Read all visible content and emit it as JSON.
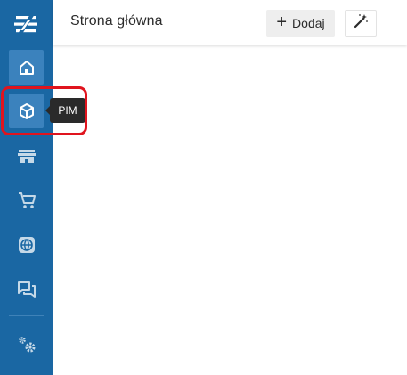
{
  "colors": {
    "sidebar_bg": "#1a67a3",
    "sidebar_active": "#3b82bd",
    "tooltip_bg": "#2a2a2a",
    "highlight": "#e0141e"
  },
  "sidebar": {
    "logo_icon": "logo-icon",
    "items": [
      {
        "id": "home",
        "icon": "home-icon",
        "active": true
      },
      {
        "id": "pim",
        "icon": "cube-icon",
        "active": true,
        "tooltip": "PIM"
      },
      {
        "id": "store",
        "icon": "storefront-icon"
      },
      {
        "id": "cart",
        "icon": "cart-icon"
      },
      {
        "id": "globe",
        "icon": "globe-icon"
      },
      {
        "id": "chat",
        "icon": "chat-icon"
      },
      {
        "id": "settings",
        "icon": "gears-icon"
      }
    ]
  },
  "header": {
    "title": "Strona główna",
    "add_label": "Dodaj",
    "add_icon": "plus-icon",
    "magic_icon": "magic-wand-icon"
  },
  "tooltip": {
    "text": "PIM"
  }
}
